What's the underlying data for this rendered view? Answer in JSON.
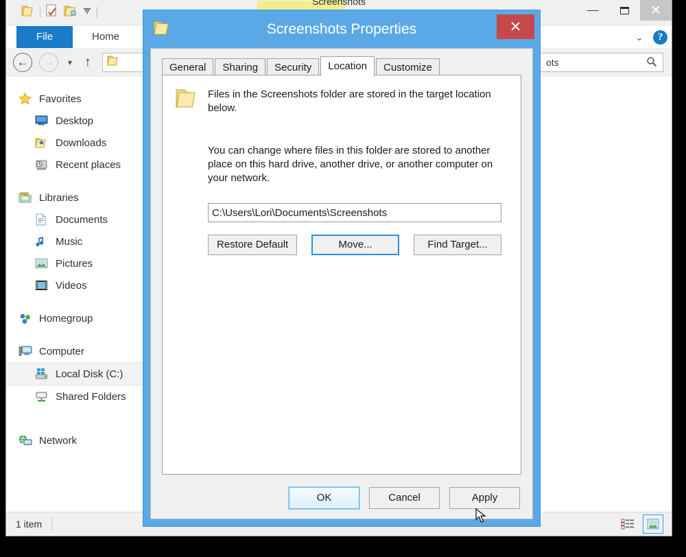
{
  "explorer": {
    "window_title": "Screenshots",
    "quick_access": [
      {
        "name": "folder-icon",
        "label": "Folder"
      },
      {
        "name": "properties-icon",
        "label": "Properties"
      },
      {
        "name": "new-folder-icon",
        "label": "New folder"
      },
      {
        "name": "customize-qat-icon",
        "label": "Customize Quick Access Toolbar"
      }
    ],
    "window_controls": {
      "minimize": "–",
      "maximize": "□",
      "close": "✕"
    },
    "ribbon": {
      "tabs": [
        {
          "label": "File",
          "active": true
        },
        {
          "label": "Home",
          "active": false
        }
      ],
      "collapse_label": "⌄",
      "help_label": "?"
    },
    "addressbar": {
      "back_label": "←",
      "forward_label": "→",
      "recent_label": "▾",
      "up_label": "↑",
      "breadcrumb": "",
      "search_value": "ots",
      "search_icon": "⌕"
    },
    "navpane": {
      "groups": [
        {
          "header": {
            "label": "Favorites",
            "icon": "star-icon"
          },
          "items": [
            {
              "label": "Desktop",
              "icon": "desktop-icon"
            },
            {
              "label": "Downloads",
              "icon": "downloads-icon"
            },
            {
              "label": "Recent places",
              "icon": "recent-places-icon"
            }
          ]
        },
        {
          "header": {
            "label": "Libraries",
            "icon": "libraries-icon"
          },
          "items": [
            {
              "label": "Documents",
              "icon": "documents-icon"
            },
            {
              "label": "Music",
              "icon": "music-icon"
            },
            {
              "label": "Pictures",
              "icon": "pictures-icon"
            },
            {
              "label": "Videos",
              "icon": "videos-icon"
            }
          ]
        },
        {
          "header": {
            "label": "Homegroup",
            "icon": "homegroup-icon"
          },
          "items": []
        },
        {
          "header": {
            "label": "Computer",
            "icon": "computer-icon"
          },
          "items": [
            {
              "label": "Local Disk (C:)",
              "icon": "local-disk-icon",
              "selected": true
            },
            {
              "label": "Shared Folders",
              "icon": "shared-folders-icon"
            }
          ]
        },
        {
          "header": {
            "label": "Network",
            "icon": "network-icon"
          },
          "items": []
        }
      ]
    },
    "statusbar": {
      "item_count": "1 item",
      "views": [
        {
          "name": "details-view-button",
          "active": false
        },
        {
          "name": "large-icons-view-button",
          "active": true
        }
      ]
    }
  },
  "dialog": {
    "title": "Screenshots Properties",
    "close_label": "✕",
    "tabs": [
      {
        "label": "General",
        "active": false
      },
      {
        "label": "Sharing",
        "active": false
      },
      {
        "label": "Security",
        "active": false
      },
      {
        "label": "Location",
        "active": true
      },
      {
        "label": "Customize",
        "active": false
      }
    ],
    "location": {
      "paragraph1": "Files in the Screenshots folder are stored in the target location below.",
      "paragraph2": "You can change where files in this folder are stored to another place on this hard drive, another drive, or another computer on your network.",
      "path_value": "C:\\Users\\Lori\\Documents\\Screenshots",
      "buttons": [
        {
          "label": "Restore Default",
          "state": "normal"
        },
        {
          "label": "Move...",
          "state": "focused"
        },
        {
          "label": "Find Target...",
          "state": "normal"
        }
      ]
    },
    "footer_buttons": [
      {
        "label": "OK",
        "state": "hover"
      },
      {
        "label": "Cancel",
        "state": "normal"
      },
      {
        "label": "Apply",
        "state": "normal"
      }
    ]
  },
  "colors": {
    "dialog_frame": "#5aa9e6",
    "close_red": "#c7484a",
    "file_tab_blue": "#1a7bc9",
    "contextual_tab_yellow": "#f0ef90",
    "focus_blue": "#2d8fe0"
  }
}
